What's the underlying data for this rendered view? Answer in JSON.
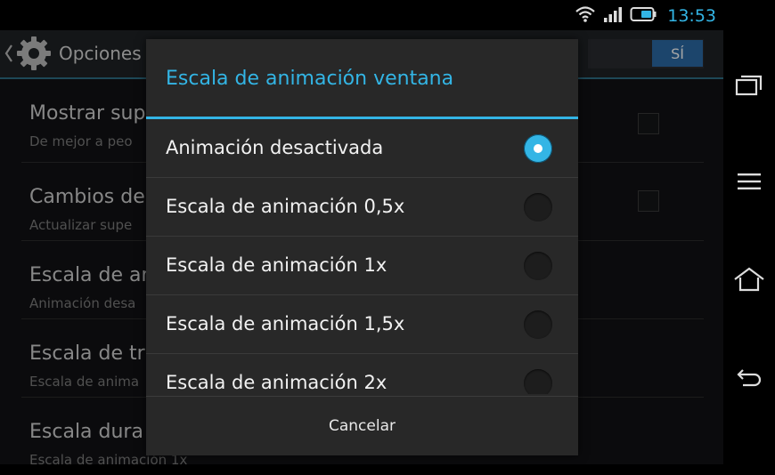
{
  "status_bar": {
    "time": "13:53"
  },
  "app": {
    "title": "Opciones",
    "switch_on_label": "SÍ",
    "rows": [
      {
        "title": "Mostrar sup",
        "subtitle": "De mejor a peo"
      },
      {
        "title": "Cambios de",
        "subtitle": "Actualizar supe"
      },
      {
        "title": "Escala de an",
        "subtitle": "Animación desa"
      },
      {
        "title": "Escala de tra",
        "subtitle": "Escala de anima"
      },
      {
        "title": "Escala dura",
        "subtitle": "Escala de animación 1x"
      }
    ]
  },
  "dialog": {
    "title": "Escala de animación ventana",
    "options": [
      {
        "label": "Animación desactivada"
      },
      {
        "label": "Escala de animación 0,5x"
      },
      {
        "label": "Escala de animación 1x"
      },
      {
        "label": "Escala de animación 1,5x"
      },
      {
        "label": "Escala de animación 2x"
      }
    ],
    "cancel_label": "Cancelar"
  },
  "colors": {
    "accent": "#33b5e5",
    "switch_on": "#2b6aa6"
  }
}
